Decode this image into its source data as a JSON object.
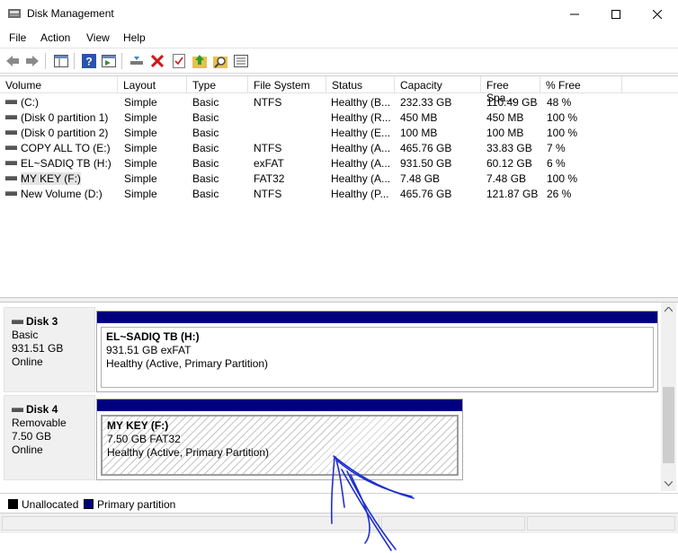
{
  "window": {
    "title": "Disk Management",
    "controls": [
      "minimize",
      "maximize",
      "close"
    ]
  },
  "menu": [
    "File",
    "Action",
    "View",
    "Help"
  ],
  "toolbar": {
    "buttons": [
      "back-icon",
      "forward-icon",
      "show-hide-tree-icon",
      "help-icon",
      "properties-icon",
      "connect-icon",
      "delete-icon",
      "check-icon",
      "up-icon",
      "search-icon",
      "settings-icon"
    ]
  },
  "volume_list": {
    "columns": [
      "Volume",
      "Layout",
      "Type",
      "File System",
      "Status",
      "Capacity",
      "Free Spa...",
      "% Free"
    ],
    "rows": [
      [
        "(C:)",
        "Simple",
        "Basic",
        "NTFS",
        "Healthy (B...",
        "232.33 GB",
        "110.49 GB",
        "48 %"
      ],
      [
        "(Disk 0 partition 1)",
        "Simple",
        "Basic",
        "",
        "Healthy (R...",
        "450 MB",
        "450 MB",
        "100 %"
      ],
      [
        "(Disk 0 partition 2)",
        "Simple",
        "Basic",
        "",
        "Healthy (E...",
        "100 MB",
        "100 MB",
        "100 %"
      ],
      [
        "COPY ALL TO (E:)",
        "Simple",
        "Basic",
        "NTFS",
        "Healthy (A...",
        "465.76 GB",
        "33.83 GB",
        "7 %"
      ],
      [
        "EL~SADIQ TB (H:)",
        "Simple",
        "Basic",
        "exFAT",
        "Healthy (A...",
        "931.50 GB",
        "60.12 GB",
        "6 %"
      ],
      [
        "MY KEY (F:)",
        "Simple",
        "Basic",
        "FAT32",
        "Healthy (A...",
        "7.48 GB",
        "7.48 GB",
        "100 %"
      ],
      [
        "New Volume (D:)",
        "Simple",
        "Basic",
        "NTFS",
        "Healthy (P...",
        "465.76 GB",
        "121.87 GB",
        "26 %"
      ]
    ],
    "selected_row": 5
  },
  "disks": [
    {
      "name": "Disk 3",
      "type": "Basic",
      "size": "931.51 GB",
      "status": "Online",
      "partition": {
        "title": "EL~SADIQ TB  (H:)",
        "size_fs": "931.51 GB exFAT",
        "status": "Healthy (Active, Primary Partition)"
      }
    },
    {
      "name": "Disk 4",
      "type": "Removable",
      "size": "7.50 GB",
      "status": "Online",
      "partition": {
        "title": "MY KEY  (F:)",
        "size_fs": "7.50 GB FAT32",
        "status": "Healthy (Active, Primary Partition)"
      }
    }
  ],
  "legend": [
    {
      "label": "Unallocated",
      "color": "#000000"
    },
    {
      "label": "Primary partition",
      "color": "#00007f"
    }
  ],
  "colors": {
    "primary_partition": "#00007f",
    "annotation_ink": "#1f2fd0"
  }
}
